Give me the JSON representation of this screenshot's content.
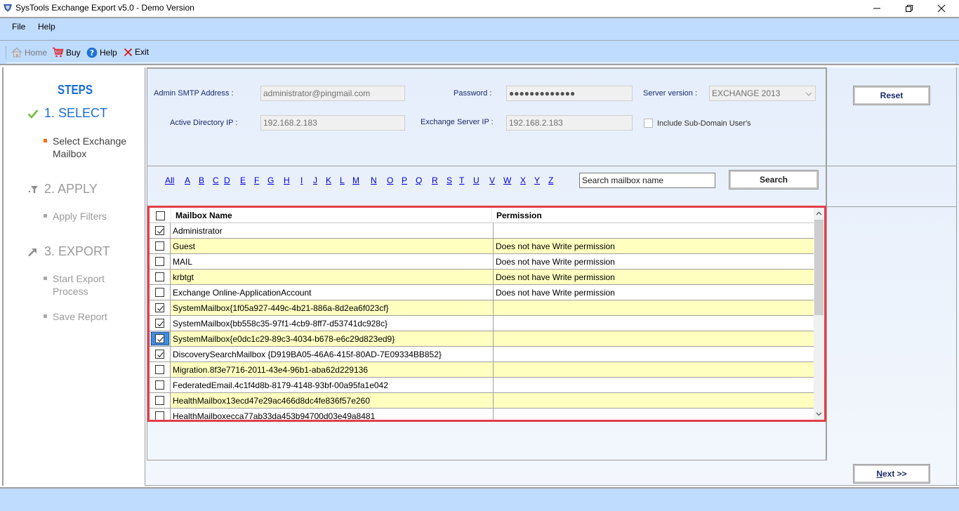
{
  "window": {
    "title": "SysTools Exchange Export v5.0 - Demo Version"
  },
  "menu": {
    "items": [
      "File",
      "Help"
    ]
  },
  "toolbar": {
    "home": "Home",
    "buy": "Buy",
    "help": "Help",
    "exit": "Exit"
  },
  "steps": {
    "title": "STEPS",
    "step1": {
      "label": "1. SELECT",
      "sub": [
        "Select Exchange",
        "Mailbox"
      ]
    },
    "step2": {
      "label": "2. APPLY",
      "sub": [
        "Apply Filters"
      ]
    },
    "step3": {
      "label": "3. EXPORT",
      "sub1": [
        "Start Export",
        "Process"
      ],
      "sub2": "Save Report"
    }
  },
  "form": {
    "admin_smtp_label": "Admin SMTP Address :",
    "admin_smtp_value": "administrator@pingmail.com",
    "password_label": "Password :",
    "password_value": "●●●●●●●●●●●●●",
    "server_version_label": "Server version :",
    "server_version_value": "EXCHANGE 2013",
    "ad_ip_label": "Active Directory IP :",
    "ad_ip_value": "192.168.2.183",
    "exchange_ip_label": "Exchange Server IP :",
    "exchange_ip_value": "192.168.2.183",
    "include_subdomain_label": "Include Sub-Domain User's",
    "include_subdomain_checked": false
  },
  "buttons": {
    "reset": "Reset",
    "search": "Search",
    "next": "Next >>"
  },
  "alphabet": [
    "All",
    "A",
    "B",
    "C",
    "D",
    "E",
    "F",
    "G",
    "H",
    "I",
    "J",
    "K",
    "L",
    "M",
    "N",
    "O",
    "P",
    "Q",
    "R",
    "S",
    "T",
    "U",
    "V",
    "W",
    "X",
    "Y",
    "Z"
  ],
  "search": {
    "value": "Search mailbox name"
  },
  "grid": {
    "columns": [
      "Mailbox Name",
      "Permission"
    ],
    "select_all_checked": false,
    "rows": [
      {
        "name": "Administrator",
        "permission": "",
        "checked": true
      },
      {
        "name": "Guest",
        "permission": "Does not have Write permission",
        "checked": false
      },
      {
        "name": "MAIL",
        "permission": "Does not have Write permission",
        "checked": false
      },
      {
        "name": "krbtgt",
        "permission": "Does not have Write permission",
        "checked": false
      },
      {
        "name": "Exchange Online-ApplicationAccount",
        "permission": "Does not have Write permission",
        "checked": false
      },
      {
        "name": "SystemMailbox{1f05a927-449c-4b21-886a-8d2ea6f023cf}",
        "permission": "",
        "checked": true
      },
      {
        "name": "SystemMailbox{bb558c35-97f1-4cb9-8ff7-d53741dc928c}",
        "permission": "",
        "checked": true
      },
      {
        "name": "SystemMailbox{e0dc1c29-89c3-4034-b678-e6c29d823ed9}",
        "permission": "",
        "checked": true,
        "focused": true
      },
      {
        "name": "DiscoverySearchMailbox {D919BA05-46A6-415f-80AD-7E09334BB852}",
        "permission": "",
        "checked": true
      },
      {
        "name": "Migration.8f3e7716-2011-43e4-96b1-aba62d229136",
        "permission": "",
        "checked": false
      },
      {
        "name": "FederatedEmail.4c1f4d8b-8179-4148-93bf-00a95fa1e042",
        "permission": "",
        "checked": false
      },
      {
        "name": "HealthMailbox13ecd47e29ac466d8dc4fe836f57e260",
        "permission": "",
        "checked": false
      },
      {
        "name": "HealthMailboxecca77ab33da453b94700d03e49a8481",
        "permission": "",
        "checked": false
      }
    ]
  },
  "colors": {
    "accent_blue": "#1a6dd8",
    "highlight_border": "#e53e48",
    "row_alt": "#ffffc0",
    "bar_blue": "#bfdbfe",
    "bullet_active": "#ff6a00"
  }
}
